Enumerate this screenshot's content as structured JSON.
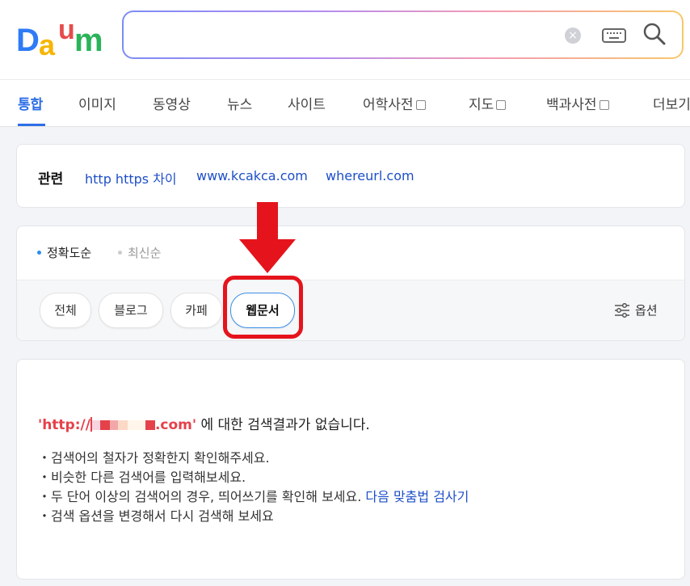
{
  "logo": {
    "letters": [
      "D",
      "a",
      "u",
      "m"
    ],
    "colors": [
      "#2e7bf6",
      "#f6b500",
      "#e64b4b",
      "#2ab45a"
    ]
  },
  "search": {
    "value": "",
    "placeholder": ""
  },
  "icons": {
    "clear": "clear-icon",
    "keyboard": "keyboard-icon",
    "search": "search-icon"
  },
  "tabs": [
    {
      "label": "통합",
      "active": true
    },
    {
      "label": "이미지"
    },
    {
      "label": "동영상"
    },
    {
      "label": "뉴스"
    },
    {
      "label": "사이트"
    },
    {
      "label": "어학사전",
      "external": true
    },
    {
      "label": "지도",
      "external": true
    },
    {
      "label": "백과사전",
      "external": true
    },
    {
      "label": "더보기"
    }
  ],
  "related": {
    "title": "관련",
    "links": [
      "http https 차이",
      "www.kcakca.com",
      "whereurl.com"
    ]
  },
  "sort": {
    "items": [
      {
        "label": "정확도순",
        "selected": true
      },
      {
        "label": "최신순",
        "selected": false
      }
    ]
  },
  "chips": [
    {
      "label": "전체"
    },
    {
      "label": "블로그"
    },
    {
      "label": "카페"
    },
    {
      "label": "웹문서",
      "selected": true
    }
  ],
  "options_label": "옵션",
  "result": {
    "query_prefix": "'http://",
    "query_suffix": ".com'",
    "message": " 에 대한 검색결과가 없습니다.",
    "tips": [
      "・검색어의 철자가 정확한지 확인해주세요.",
      "・비슷한 다른 검색어를 입력해보세요.",
      "・두 단어 이상의 검색어의 경우, 띄어쓰기를 확인해 보세요. ",
      "・검색 옵션을 변경해서 다시 검색해 보세요"
    ],
    "tip_link": "다음 맞춤법 검사기"
  },
  "colors": {
    "accent": "#2c6ee6",
    "link": "#1e4fc7",
    "highlight": "#e5141c",
    "query": "#e5414a"
  }
}
